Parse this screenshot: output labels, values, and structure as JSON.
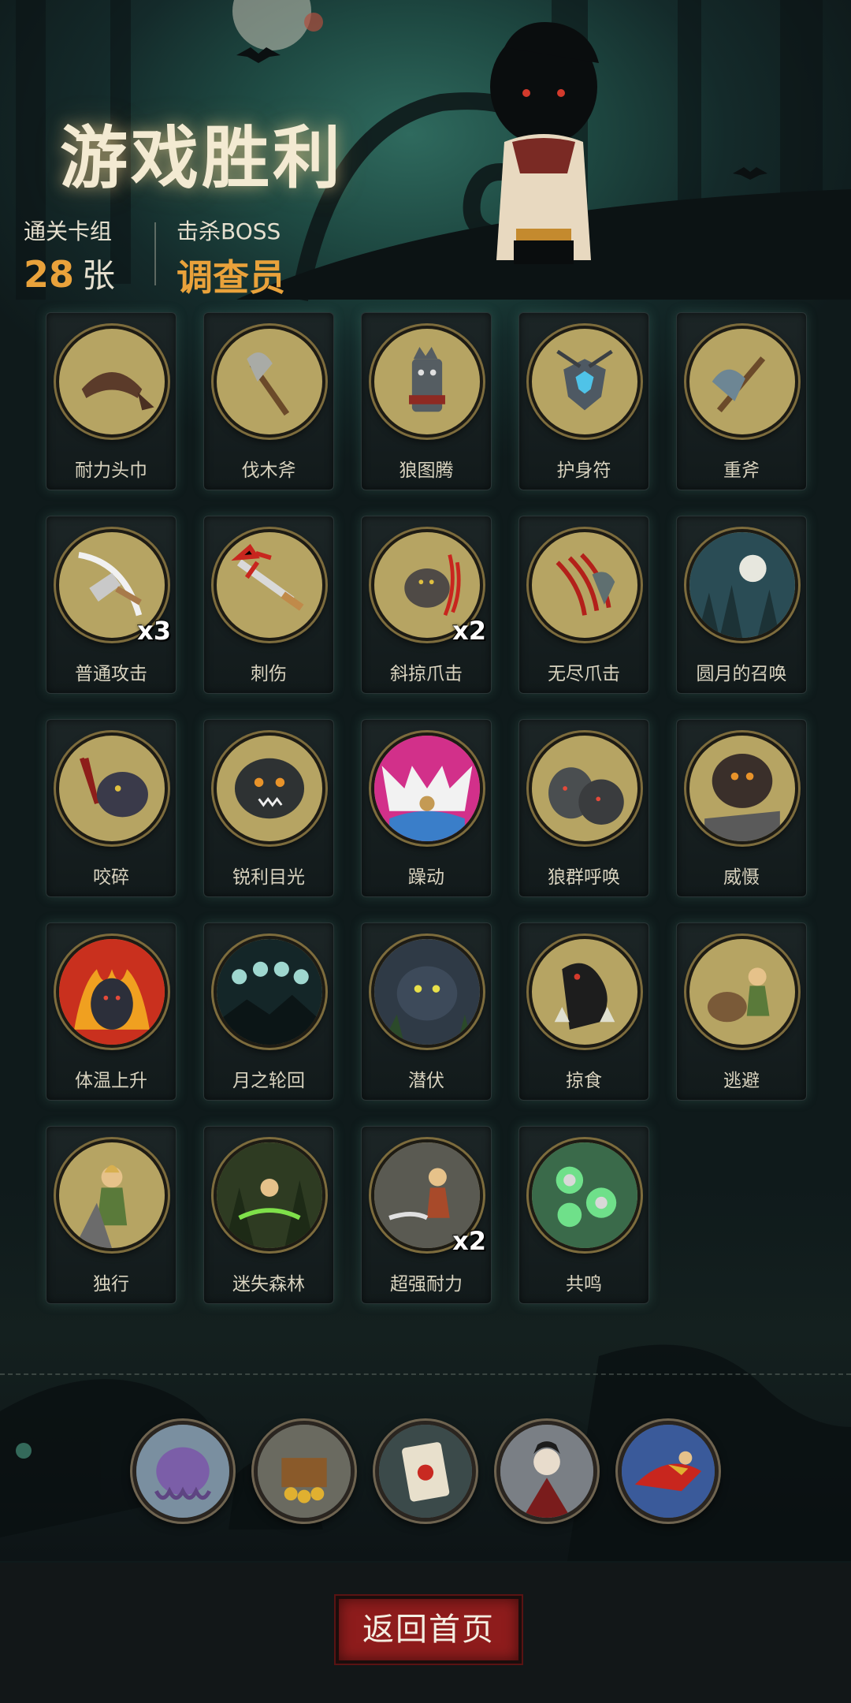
{
  "header": {
    "title": "游戏胜利",
    "stats": [
      {
        "label": "通关卡组",
        "value": "28",
        "unit": "张"
      },
      {
        "label": "击杀BOSS",
        "value": "调查员"
      }
    ]
  },
  "cards": [
    {
      "name": "耐力头巾",
      "icon": "bandana-icon"
    },
    {
      "name": "伐木斧",
      "icon": "axe-icon"
    },
    {
      "name": "狼图腾",
      "icon": "wolf-totem-icon"
    },
    {
      "name": "护身符",
      "icon": "amulet-icon"
    },
    {
      "name": "重斧",
      "icon": "heavy-axe-icon"
    },
    {
      "name": "普通攻击",
      "icon": "slash-attack-icon",
      "count": "x3"
    },
    {
      "name": "刺伤",
      "icon": "stab-icon"
    },
    {
      "name": "斜掠爪击",
      "icon": "claw-slash-icon",
      "count": "x2"
    },
    {
      "name": "无尽爪击",
      "icon": "endless-claw-icon"
    },
    {
      "name": "圆月的召唤",
      "icon": "full-moon-icon"
    },
    {
      "name": "咬碎",
      "icon": "bite-icon"
    },
    {
      "name": "锐利目光",
      "icon": "sharp-gaze-icon"
    },
    {
      "name": "躁动",
      "icon": "frenzy-icon"
    },
    {
      "name": "狼群呼唤",
      "icon": "wolf-pack-icon"
    },
    {
      "name": "威慑",
      "icon": "intimidate-icon"
    },
    {
      "name": "体温上升",
      "icon": "flame-wolf-icon"
    },
    {
      "name": "月之轮回",
      "icon": "moon-phases-icon"
    },
    {
      "name": "潜伏",
      "icon": "lurk-icon"
    },
    {
      "name": "掠食",
      "icon": "predator-icon"
    },
    {
      "name": "逃避",
      "icon": "escape-icon"
    },
    {
      "name": "独行",
      "icon": "lone-walker-icon"
    },
    {
      "name": "迷失森林",
      "icon": "lost-forest-icon"
    },
    {
      "name": "超强耐力",
      "icon": "endurance-icon",
      "count": "x2"
    },
    {
      "name": "共鸣",
      "icon": "resonance-icon"
    }
  ],
  "relics": [
    {
      "icon": "tentacle-creature-icon"
    },
    {
      "icon": "treasure-chest-icon"
    },
    {
      "icon": "playing-card-icon"
    },
    {
      "icon": "vampire-icon"
    },
    {
      "icon": "flying-hero-icon"
    }
  ],
  "footer": {
    "home_button": "返回首页"
  },
  "colors": {
    "accent": "#e9a23b",
    "button": "#8e1c1c",
    "medal": "#b6a463",
    "background": "#0f1719"
  }
}
